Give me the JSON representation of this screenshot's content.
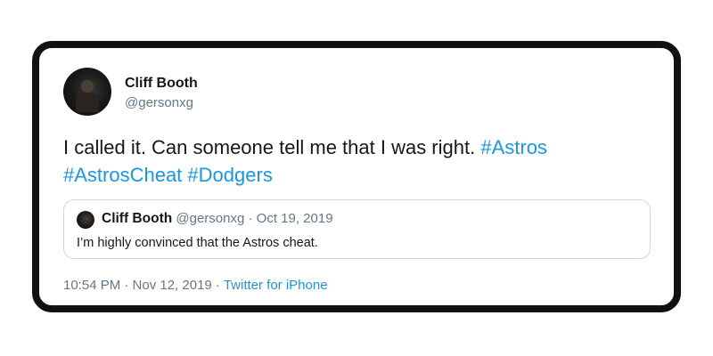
{
  "tweet": {
    "display_name": "Cliff Booth",
    "handle": "@gersonxg",
    "text_before": "I called it. Can someone tell me that I was right.",
    "hashtags": [
      "#Astros",
      "#AstrosCheat",
      "#Dodgers"
    ],
    "timestamp": "10:54 PM · Nov 12, 2019",
    "separator": " · ",
    "source": "Twitter for iPhone"
  },
  "quoted_tweet": {
    "display_name": "Cliff Booth",
    "handle": "@gersonxg",
    "separator": " · ",
    "date": "Oct 19, 2019",
    "text": "I’m highly convinced that the Astros cheat."
  },
  "colors": {
    "link": "#1b95e0",
    "secondary_text": "#657786",
    "primary_text": "#14171a",
    "card_border": "#111111"
  },
  "icons": {
    "avatar": "profile-photo",
    "quote_avatar": "profile-photo-small"
  }
}
